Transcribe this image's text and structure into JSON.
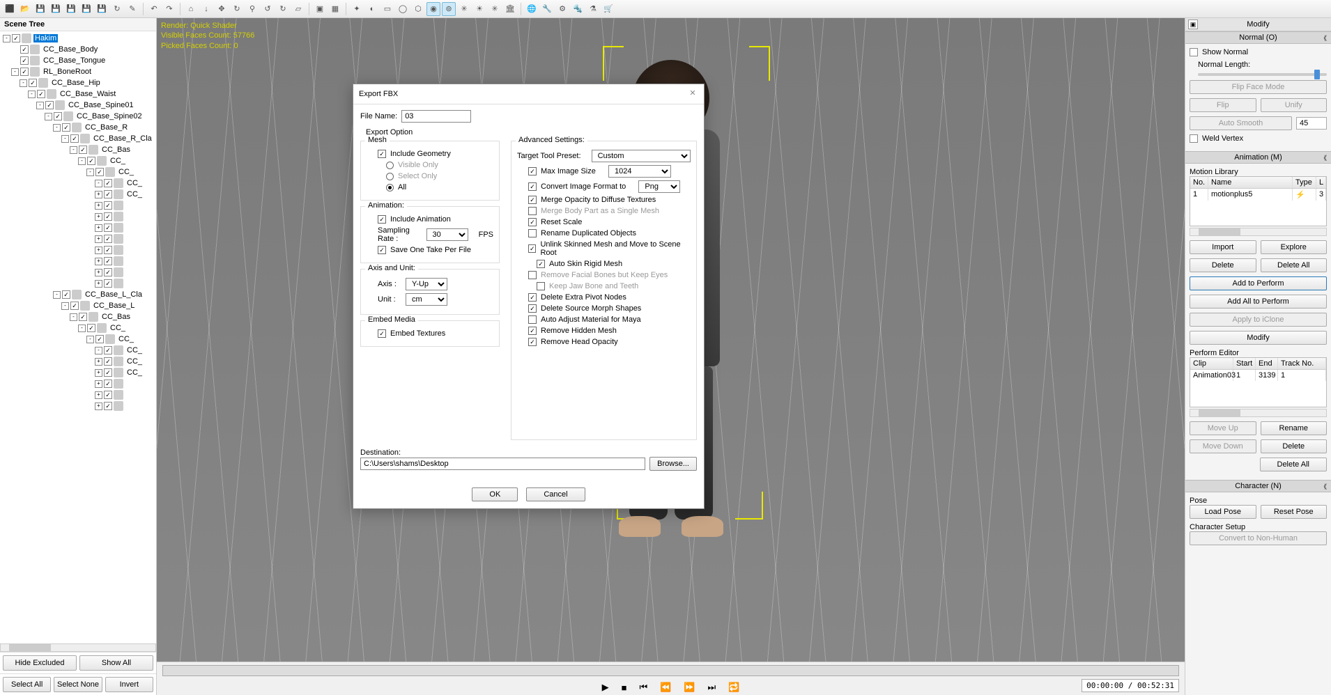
{
  "toolbar_icons": [
    "⬛",
    "📂",
    "💾",
    "💾",
    "💾",
    "💾",
    "💾",
    "↻",
    "✎",
    "|",
    "↶",
    "↷",
    "|",
    "⌂",
    "↓",
    "✥",
    "↻",
    "⚲",
    "↺",
    "↻",
    "▱",
    "|",
    "▣",
    "▦",
    "|",
    "✦",
    "◐",
    "▭",
    "◯",
    "⬡",
    "◉",
    "⊚",
    "✳",
    "☀",
    "✳",
    "🏛",
    "|",
    "🌐",
    "🔧",
    "⚙",
    "🔩",
    "⚗",
    "🛒"
  ],
  "scene_tree": {
    "title": "Scene Tree",
    "root": "Hakim",
    "nodes": [
      {
        "d": 1,
        "l": "CC_Base_Body"
      },
      {
        "d": 1,
        "l": "CC_Base_Tongue"
      },
      {
        "d": 1,
        "l": "RL_BoneRoot",
        "exp": "-"
      },
      {
        "d": 2,
        "l": "CC_Base_Hip",
        "exp": "-"
      },
      {
        "d": 3,
        "l": "CC_Base_Waist",
        "exp": "-"
      },
      {
        "d": 4,
        "l": "CC_Base_Spine01",
        "exp": "-"
      },
      {
        "d": 5,
        "l": "CC_Base_Spine02",
        "exp": "-"
      },
      {
        "d": 6,
        "l": "CC_Base_R",
        "exp": "-"
      },
      {
        "d": 7,
        "l": "CC_Base_R_Cla",
        "exp": "-"
      },
      {
        "d": 8,
        "l": "CC_Bas",
        "exp": "-"
      },
      {
        "d": 9,
        "l": "CC_",
        "exp": "-"
      },
      {
        "d": 10,
        "l": "CC_",
        "exp": "-"
      },
      {
        "d": 11,
        "l": "CC_",
        "exp": "-"
      },
      {
        "d": 11,
        "l": "CC_",
        "exp": "+"
      },
      {
        "d": 11,
        "l": "",
        "exp": "+"
      },
      {
        "d": 11,
        "l": "",
        "exp": "+"
      },
      {
        "d": 11,
        "l": "",
        "exp": "+"
      },
      {
        "d": 11,
        "l": "",
        "exp": "+"
      },
      {
        "d": 11,
        "l": "",
        "exp": "+"
      },
      {
        "d": 11,
        "l": "",
        "exp": "+"
      },
      {
        "d": 11,
        "l": "",
        "exp": "+"
      },
      {
        "d": 11,
        "l": "",
        "exp": "+"
      },
      {
        "d": 6,
        "l": "CC_Base_L_Cla",
        "exp": "-"
      },
      {
        "d": 7,
        "l": "CC_Base_L",
        "exp": "-"
      },
      {
        "d": 8,
        "l": "CC_Bas",
        "exp": "-"
      },
      {
        "d": 9,
        "l": "CC_",
        "exp": "-"
      },
      {
        "d": 10,
        "l": "CC_",
        "exp": "-"
      },
      {
        "d": 11,
        "l": "CC_",
        "exp": "-"
      },
      {
        "d": 11,
        "l": "CC_",
        "exp": "+"
      },
      {
        "d": 11,
        "l": "CC_",
        "exp": "+"
      },
      {
        "d": 11,
        "l": "",
        "exp": "+"
      },
      {
        "d": 11,
        "l": "",
        "exp": "+"
      },
      {
        "d": 11,
        "l": "",
        "exp": "+"
      }
    ],
    "btns": {
      "hide": "Hide Excluded",
      "show": "Show All",
      "selall": "Select All",
      "selnone": "Select None",
      "invert": "Invert"
    }
  },
  "viewport": {
    "render_line1": "Render: Quick Shader",
    "render_line2": "Visible Faces Count: 57766",
    "render_line3": "Picked Faces Count: 0",
    "time": "00:00:00 / 00:52:31"
  },
  "dialog": {
    "title": "Export FBX",
    "file_name_label": "File Name:",
    "file_name": "03",
    "export_option": "Export Option",
    "mesh": "Mesh",
    "include_geometry": "Include Geometry",
    "visible_only": "Visible Only",
    "select_only": "Select Only",
    "all": "All",
    "animation": "Animation:",
    "include_animation": "Include Animation",
    "sampling_rate": "Sampling Rate :",
    "sampling_val": "30",
    "fps": "FPS",
    "save_one_take": "Save One Take Per File",
    "axis_unit": "Axis and Unit:",
    "axis": "Axis :",
    "axis_val": "Y-Up",
    "unit": "Unit :",
    "unit_val": "cm",
    "embed_media": "Embed Media",
    "embed_textures": "Embed Textures",
    "advanced": "Advanced Settings:",
    "target_preset": "Target Tool Preset:",
    "target_val": "Custom",
    "max_image": "Max Image Size",
    "max_image_val": "1024",
    "convert_format": "Convert Image Format to",
    "convert_val": "Png",
    "merge_opacity": "Merge Opacity to Diffuse Textures",
    "merge_body": "Merge Body Part as a Single Mesh",
    "reset_scale": "Reset Scale",
    "rename_dup": "Rename Duplicated Objects",
    "unlink_skinned": "Unlink Skinned Mesh and Move to Scene Root",
    "auto_skin": "Auto Skin Rigid Mesh",
    "remove_facial": "Remove Facial Bones but Keep Eyes",
    "keep_jaw": "Keep Jaw Bone and Teeth",
    "delete_pivot": "Delete Extra Pivot Nodes",
    "delete_morph": "Delete Source Morph Shapes",
    "auto_adjust": "Auto Adjust Material for Maya",
    "remove_hidden": "Remove Hidden Mesh",
    "remove_head": "Remove Head Opacity",
    "destination": "Destination:",
    "dest_path": "C:\\Users\\shams\\Desktop",
    "browse": "Browse...",
    "ok": "OK",
    "cancel": "Cancel"
  },
  "right": {
    "modify": "Modify",
    "normal_h": "Normal (O)",
    "show_normal": "Show Normal",
    "normal_length": "Normal Length:",
    "flip_face": "Flip Face Mode",
    "flip": "Flip",
    "unify": "Unify",
    "auto_smooth": "Auto Smooth",
    "smooth_val": "45",
    "weld_vertex": "Weld Vertex",
    "animation_h": "Animation (M)",
    "motion_lib": "Motion Library",
    "th_no": "No.",
    "th_name": "Name",
    "th_type": "Type",
    "th_l": "L",
    "row_no": "1",
    "row_name": "motionplus5",
    "row_l": "3",
    "import": "Import",
    "explore": "Explore",
    "delete": "Delete",
    "delete_all": "Delete All",
    "add_perform": "Add to Perform",
    "add_all": "Add All to Perform",
    "apply_iclone": "Apply to iClone",
    "modify_btn": "Modify",
    "perform_editor": "Perform Editor",
    "pe_clip": "Clip",
    "pe_start": "Start",
    "pe_end": "End",
    "pe_track": "Track No.",
    "pe_r_clip": "Animation03",
    "pe_r_start": "1",
    "pe_r_end": "3139",
    "pe_r_track": "1",
    "move_up": "Move Up",
    "rename": "Rename",
    "move_down": "Move Down",
    "character_h": "Character (N)",
    "pose": "Pose",
    "load_pose": "Load Pose",
    "reset_pose": "Reset Pose",
    "char_setup": "Character Setup",
    "convert_non": "Convert to Non-Human"
  }
}
